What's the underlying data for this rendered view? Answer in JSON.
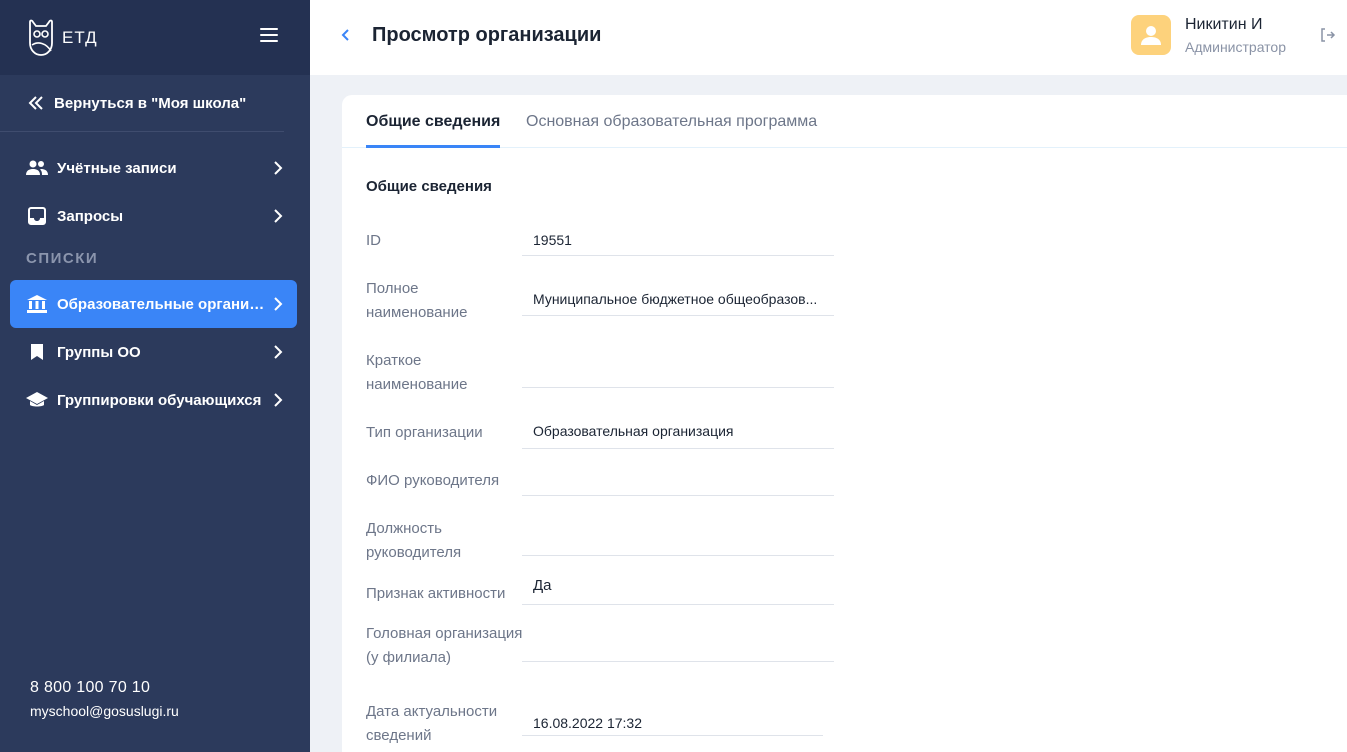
{
  "app": {
    "logo_text": "ЕТД"
  },
  "sidebar": {
    "back_label": "Вернуться в \"Моя школа\"",
    "items_top": [
      {
        "label": "Учётные записи",
        "icon": "users-icon"
      },
      {
        "label": "Запросы",
        "icon": "inbox-icon"
      }
    ],
    "section_title": "СПИСКИ",
    "items_lists": [
      {
        "label": "Образовательные организа...",
        "icon": "institution-icon",
        "active": true
      },
      {
        "label": "Группы ОО",
        "icon": "bookmark-icon"
      },
      {
        "label": "Группировки обучающихся",
        "icon": "graduation-cap-icon"
      }
    ],
    "footer": {
      "phone": "8 800 100 70 10",
      "email": "myschool@gosuslugi.ru"
    }
  },
  "header": {
    "title": "Просмотр организации",
    "user_name": "Никитин И",
    "user_role": "Администратор"
  },
  "tabs": [
    "Общие сведения",
    "Основная образовательная программа"
  ],
  "section_heading": "Общие сведения",
  "fields": [
    {
      "label": "ID",
      "value": "19551"
    },
    {
      "label": "Полное наименование",
      "value": "Муниципальное бюджетное общеобразов..."
    },
    {
      "label": "Краткое наименование",
      "value": ""
    },
    {
      "label": "Тип организации",
      "value": "Образовательная организация"
    },
    {
      "label": "ФИО руководителя",
      "value": ""
    },
    {
      "label": "Должность руководителя",
      "value": ""
    },
    {
      "label": "Признак активности",
      "value": "Да"
    },
    {
      "label": "Головная организация (у филиала)",
      "value": ""
    },
    {
      "label": "Дата актуальности сведений",
      "value": "16.08.2022 17:32"
    }
  ],
  "colors": {
    "sidebar_bg": "#2c3a5c",
    "sidebar_top": "#243152",
    "accent": "#3a85f7",
    "avatar_bg": "#fdd27c"
  }
}
